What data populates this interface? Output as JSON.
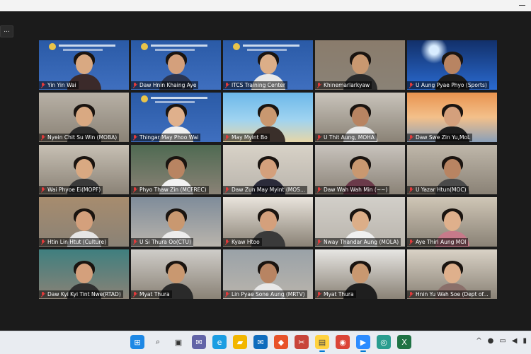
{
  "window": {
    "corner_button_label": "..."
  },
  "participants": [
    {
      "name": "Yin Yin Wai",
      "scene": "banner",
      "bg": "#2a5aa6",
      "skin": "#d9a982",
      "shirt": "#3b2a2a",
      "muted": true,
      "active": false
    },
    {
      "name": "Daw Hnin Khaing Aye",
      "scene": "banner",
      "bg": "#2a5aa6",
      "skin": "#d4a07c",
      "shirt": "#2b3550",
      "muted": true,
      "active": true
    },
    {
      "name": "ITCS Training Center",
      "scene": "banner",
      "bg": "#2a5aa6",
      "skin": "#dcae88",
      "shirt": "#e8e8e8",
      "muted": true,
      "active": false
    },
    {
      "name": "Khinemarlarkyaw",
      "scene": "room",
      "bg": "#8a7c6c",
      "skin": "#c99870",
      "shirt": "#2a2a2a",
      "muted": true,
      "active": false
    },
    {
      "name": "U Aung Pyae Phyo (Sports)",
      "scene": "stadium",
      "bg": "#1a3e7a",
      "skin": "#b88462",
      "shirt": "#1d1d1d",
      "muted": true,
      "active": false
    },
    {
      "name": "Nyein Chit Su Win (MOBA)",
      "scene": "room",
      "bg": "#b8b1a6",
      "skin": "#d9a982",
      "shirt": "#2a2a2a",
      "muted": true,
      "active": false
    },
    {
      "name": "Thingar May Phoo Wai",
      "scene": "banner",
      "bg": "#2a5aa6",
      "skin": "#dfb08c",
      "shirt": "#f0f0f0",
      "muted": true,
      "active": false
    },
    {
      "name": "May Myint Bo",
      "scene": "beach",
      "bg": "#5fa4d8",
      "skin": "#c99870",
      "shirt": "#3a2f2a",
      "muted": true,
      "active": false
    },
    {
      "name": "U Thit Aung, MOHA",
      "scene": "room",
      "bg": "#c9c4bb",
      "skin": "#b88462",
      "shirt": "#e9e9e9",
      "muted": true,
      "active": false
    },
    {
      "name": "Daw Swe Zin Yu,MoL",
      "scene": "bridge",
      "bg": "#e58a4a",
      "skin": "#d4a07c",
      "shirt": "#1f1f1f",
      "muted": true,
      "active": false
    },
    {
      "name": "Wai Phyoe Ei(MOPF)",
      "scene": "room",
      "bg": "#c7c0b4",
      "skin": "#d9a982",
      "shirt": "#3a3a3a",
      "muted": true,
      "active": false
    },
    {
      "name": "Phyo Thaw Zin (MCFREC)",
      "scene": "room",
      "bg": "#4f6a52",
      "skin": "#b88462",
      "shirt": "#f2f2f2",
      "muted": true,
      "active": false
    },
    {
      "name": "Daw Zun May Myint (MOS...",
      "scene": "office",
      "bg": "#d8d2c7",
      "skin": "#d4a07c",
      "shirt": "#2b2b3a",
      "muted": true,
      "active": false
    },
    {
      "name": "Daw Wah Wah Min (~~)",
      "scene": "room",
      "bg": "#c8c3bd",
      "skin": "#c99870",
      "shirt": "#6b3a4a",
      "muted": true,
      "active": false
    },
    {
      "name": "U Yazar Htun(MOC)",
      "scene": "room",
      "bg": "#bfb7aa",
      "skin": "#b88462",
      "shirt": "#4a4a4a",
      "muted": true,
      "active": false
    },
    {
      "name": "Htin Lin Htut (Culture)",
      "scene": "room",
      "bg": "#a78c6e",
      "skin": "#d4a07c",
      "shirt": "#e5e5e5",
      "muted": true,
      "active": false
    },
    {
      "name": "U Si Thura Oo(CTU)",
      "scene": "office",
      "bg": "#7f8c9a",
      "skin": "#c99870",
      "shirt": "#ececec",
      "muted": true,
      "active": false
    },
    {
      "name": "Kyaw Htoo",
      "scene": "room",
      "bg": "#e9e4dc",
      "skin": "#d4a07c",
      "shirt": "#3a3a3a",
      "muted": true,
      "active": false
    },
    {
      "name": "Nway Thandar Aung (MOLA)",
      "scene": "office",
      "bg": "#d2cfc9",
      "skin": "#dcae88",
      "shirt": "#f0f0f0",
      "muted": true,
      "active": false
    },
    {
      "name": "Aye Thiri Aung MOI",
      "scene": "room",
      "bg": "#cfc6b6",
      "skin": "#dfb08c",
      "shirt": "#c77a8a",
      "muted": true,
      "active": false
    },
    {
      "name": "Daw Kyi Kyi Tint Nwe(RTAD)",
      "scene": "room",
      "bg": "#3f7f7f",
      "skin": "#d4a07c",
      "shirt": "#2f2f2f",
      "muted": true,
      "active": false
    },
    {
      "name": "Myat Thura",
      "scene": "room",
      "bg": "#cfcdc9",
      "skin": "#c99870",
      "shirt": "#2a2a2a",
      "muted": true,
      "active": false
    },
    {
      "name": "Lin Pyae Sone Aung (MRTV)",
      "scene": "office",
      "bg": "#9aa2a8",
      "skin": "#b88462",
      "shirt": "#e8e8e8",
      "muted": true,
      "active": false
    },
    {
      "name": "Myat Thura",
      "scene": "room",
      "bg": "#e7e6e3",
      "skin": "#c99870",
      "shirt": "#1f1f1f",
      "muted": true,
      "active": false
    },
    {
      "name": "Hnin Yu Wah Soe (Dept of...",
      "scene": "room",
      "bg": "#d9d2c6",
      "skin": "#dfb08c",
      "shirt": "#8a6f6a",
      "muted": true,
      "active": false
    }
  ],
  "taskbar": {
    "apps": [
      {
        "icon": "windows-start-icon",
        "color": "#1e88e5",
        "active": false
      },
      {
        "icon": "search-icon",
        "color": "#333333",
        "active": false
      },
      {
        "icon": "task-view-icon",
        "color": "#333333",
        "active": false
      },
      {
        "icon": "chat-icon",
        "color": "#6264a7",
        "active": false
      },
      {
        "icon": "edge-icon",
        "color": "#1b9de2",
        "active": false
      },
      {
        "icon": "file-explorer-icon",
        "color": "#f2b600",
        "active": false
      },
      {
        "icon": "mail-icon",
        "color": "#0f6cbd",
        "active": false
      },
      {
        "icon": "app-orange-icon",
        "color": "#e8532a",
        "active": false
      },
      {
        "icon": "snipping-icon",
        "color": "#c8443a",
        "active": false
      },
      {
        "icon": "sticky-notes-icon",
        "color": "#ffd23f",
        "active": true
      },
      {
        "icon": "chrome-icon",
        "color": "#db4437",
        "active": false
      },
      {
        "icon": "zoom-icon",
        "color": "#2d8cff",
        "active": true
      },
      {
        "icon": "app-globe-icon",
        "color": "#2a9d8f",
        "active": false
      },
      {
        "icon": "excel-icon",
        "color": "#1f7244",
        "active": false
      }
    ],
    "tray": [
      {
        "icon": "chevron-up-icon",
        "glyph": "^"
      },
      {
        "icon": "microphone-icon",
        "glyph": "●"
      },
      {
        "icon": "display-icon",
        "glyph": "▭"
      },
      {
        "icon": "volume-icon",
        "glyph": "◀"
      },
      {
        "icon": "battery-icon",
        "glyph": "▮"
      }
    ]
  }
}
